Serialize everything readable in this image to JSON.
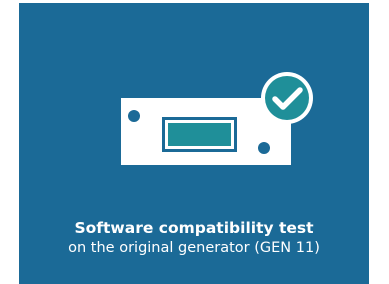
{
  "card": {
    "title": "Software compatibility test",
    "subtitle": "on the original generator (GEN 11)",
    "background_color": "#1b6a97",
    "accent_color": "#1f8f99"
  },
  "illustration": {
    "device_icon": "generator-device-icon",
    "status_icon": "checkmark-badge-icon",
    "status": "passed"
  }
}
